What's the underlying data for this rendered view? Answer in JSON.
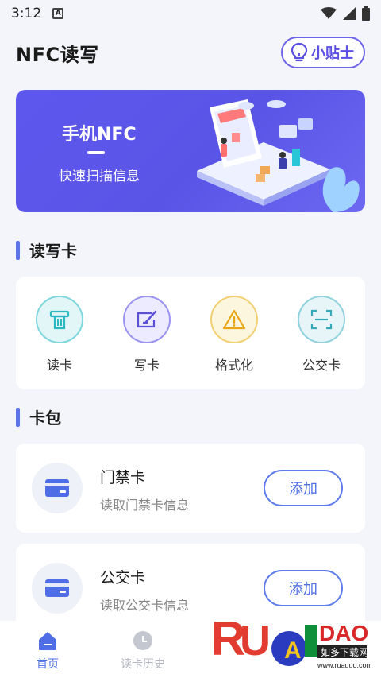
{
  "status_bar": {
    "time": "3:12",
    "badge": "A"
  },
  "header": {
    "title": "NFC读写",
    "tips_label": "小贴士"
  },
  "banner": {
    "title": "手机NFC",
    "subtitle": "快速扫描信息"
  },
  "sections": {
    "read_write": "读写卡",
    "wallet": "卡包"
  },
  "functions": [
    {
      "label": "读卡",
      "icon": "read-card-icon",
      "bg": "#e3f6f7",
      "border": "#7fd7dd",
      "color": "#2bb8c2"
    },
    {
      "label": "写卡",
      "icon": "write-card-icon",
      "bg": "#ecebff",
      "border": "#9b94ee",
      "color": "#5b50d8"
    },
    {
      "label": "格式化",
      "icon": "warning-icon",
      "bg": "#fdf6df",
      "border": "#f2cf73",
      "color": "#e9a514"
    },
    {
      "label": "公交卡",
      "icon": "scan-icon",
      "bg": "#e7f5f8",
      "border": "#90d3dd",
      "color": "#35a8ba"
    }
  ],
  "wallet": [
    {
      "name": "门禁卡",
      "desc": "读取门禁卡信息",
      "button": "添加"
    },
    {
      "name": "公交卡",
      "desc": "读取公交卡信息",
      "button": "添加"
    }
  ],
  "nav": {
    "home": "首页",
    "history": "读卡历史"
  },
  "watermark": {
    "brand": "RUADAOO",
    "site_name": "如多下载网",
    "url": "www.ruaduo.com"
  },
  "colors": {
    "accent": "#5b55e8",
    "card_icon": "#4f6ee6",
    "section_bar": "#5b75e8"
  }
}
